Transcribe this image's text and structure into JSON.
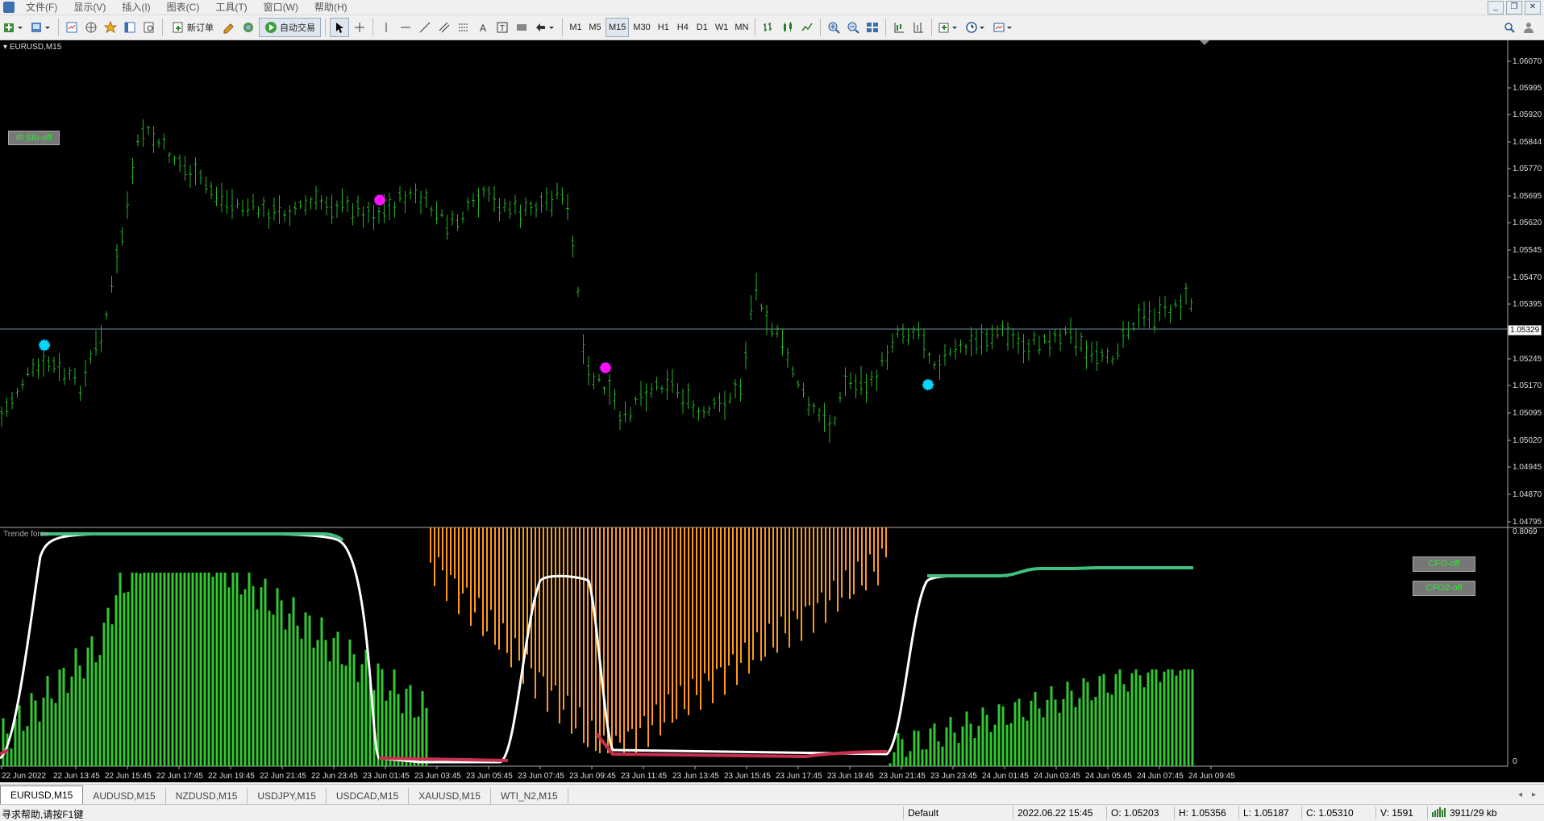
{
  "menu": [
    "文件(F)",
    "显示(V)",
    "插入(I)",
    "图表(C)",
    "工具(T)",
    "窗口(W)",
    "帮助(H)"
  ],
  "toolbar": {
    "new_order": "新订单",
    "auto_trade": "自动交易",
    "timeframes": [
      "M1",
      "M5",
      "M15",
      "M30",
      "H1",
      "H4",
      "D1",
      "W1",
      "MN"
    ],
    "active_timeframe": "M15"
  },
  "chart": {
    "symbol_title": "EURUSD,M15",
    "indicator_title": "Trende forex",
    "button_ift": "Ift Sto-off",
    "button_cfo": "CFO-off",
    "button_cfo2": "CFO2-off",
    "current_price": "1.05329",
    "price_labels": [
      "1.06070",
      "1.05995",
      "1.05920",
      "1.05844",
      "1.05770",
      "1.05695",
      "1.05620",
      "1.05545",
      "1.05470",
      "1.05395",
      "1.05245",
      "1.05170",
      "1.05095",
      "1.05020",
      "1.04945",
      "1.04870",
      "1.04795"
    ],
    "indicator_max": "0.8069",
    "indicator_zero": "0",
    "time_labels": [
      "22 Jun 2022",
      "22 Jun 13:45",
      "22 Jun 15:45",
      "22 Jun 17:45",
      "22 Jun 19:45",
      "22 Jun 21:45",
      "22 Jun 23:45",
      "23 Jun 01:45",
      "23 Jun 03:45",
      "23 Jun 05:45",
      "23 Jun 07:45",
      "23 Jun 09:45",
      "23 Jun 11:45",
      "23 Jun 13:45",
      "23 Jun 15:45",
      "23 Jun 17:45",
      "23 Jun 19:45",
      "23 Jun 21:45",
      "23 Jun 23:45",
      "24 Jun 01:45",
      "24 Jun 03:45",
      "24 Jun 05:45",
      "24 Jun 07:45",
      "24 Jun 09:45"
    ],
    "colors": {
      "bars": "#22b022",
      "histogram_up": "#32c832",
      "histogram_down": "#ff9a1a",
      "signal_up": "#00d8ff",
      "signal_down": "#ff10ff",
      "line_white": "#ffffff",
      "line_green": "#40c080",
      "line_red": "#c83050"
    }
  },
  "tabs": [
    "EURUSD,M15",
    "AUDUSD,M15",
    "NZDUSD,M15",
    "USDJPY,M15",
    "USDCAD,M15",
    "XAUUSD,M15",
    "WTI_N2,M15"
  ],
  "status": {
    "help": "寻求帮助,请按F1键",
    "profile": "Default",
    "datetime": "2022.06.22 15:45",
    "open": "O: 1.05203",
    "high": "H: 1.05356",
    "low": "L: 1.05187",
    "close": "C: 1.05310",
    "volume": "V: 1591",
    "traffic": "3911/29 kb"
  }
}
